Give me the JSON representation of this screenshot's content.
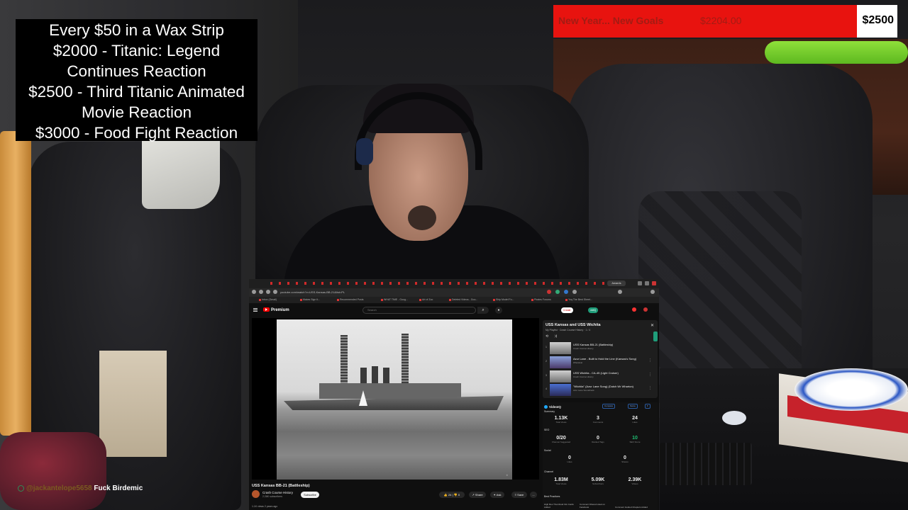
{
  "overlay": {
    "goal_list": [
      "Every $50 in a Wax Strip",
      "$2000 - Titanic: Legend",
      "Continues Reaction",
      "$2500 - Third Titanic Animated",
      "Movie Reaction",
      "$3000 - Food Fight Reaction"
    ],
    "goal_bar": {
      "title": "New Year... New Goals",
      "current": "$2204.00",
      "target": "$2500",
      "progress_percent": 88.2,
      "fill_color": "#e8130f"
    },
    "chat": {
      "username": "@jackantelope5658",
      "message": "Fuck Birdemic"
    }
  },
  "browser": {
    "tab_label": "Awards",
    "url": "youtube.com/watch?v=USS-Kansas-BB-21&list=PL",
    "bookmarks": [
      "Inbox (Gmail)",
      "Makes Sign It...",
      "Recommended Posts",
      "WHAT TIME - Goog...",
      "Art of Zoo",
      "Deleted Videos - Goo...",
      "Ship Model Fo...",
      "Pirates Forums",
      "Yoq The Best Sheet..."
    ],
    "youtube": {
      "logo": "Premium",
      "search_placeholder": "Search",
      "search_icon": "search-icon",
      "mic_icon": "mic-icon",
      "header_pills": [
        "Create",
        "vidIQ"
      ],
      "video_title": "USS Kansas BB-21 (Battleship)",
      "channel_name": "Crash Course History",
      "channel_subs": "2.26K subscribers",
      "subscribe_label": "Subscribe",
      "actions": {
        "like": "24",
        "dislike": "0",
        "share": "Share",
        "ask": "Ask",
        "save": "Save",
        "more": "..."
      },
      "views_line": "1.1K views  2 years ago",
      "playlist": {
        "title": "USS Kansas and USS Wichita",
        "meta": "My Playlist · Crash Course History · 1 / 4",
        "items": [
          {
            "index": "1",
            "title": "USS Kansas BB-21 (Battleship)",
            "sub": "Crash Course History"
          },
          {
            "index": "2",
            "title": "Azur Lane - Built to Hold the Line (Kansas's Song)",
            "sub": "Whostical"
          },
          {
            "index": "3",
            "title": "USS Wichita - CA-45 (Light Cruiser)",
            "sub": "Crash Course History"
          },
          {
            "index": "4",
            "title": "\"Wichita\" (Azur Lane Song) (Dutch Wr Wharton)",
            "sub": "Azur Lane Soundtrack"
          }
        ]
      },
      "vidiq": {
        "logo": "VideoIQ",
        "pills": [
          "Compare",
          "Score"
        ],
        "sections": [
          "Summary",
          "SEO",
          "Social",
          "Channel",
          "Best Practices"
        ],
        "stats": [
          {
            "num": "1.13K",
            "label": "Total Views"
          },
          {
            "num": "3",
            "label": "Comments"
          },
          {
            "num": "24",
            "label": "Likes"
          },
          {
            "num": "0/20",
            "label": "Channel Suggested"
          },
          {
            "num": "0",
            "label": "Ranked Tags"
          },
          {
            "num": "10",
            "label": "SEO Score"
          },
          {
            "num": "0",
            "label": "Likes"
          },
          {
            "num": "0",
            "label": "Shares"
          },
          {
            "num": "1.83M",
            "label": "Total Views"
          },
          {
            "num": "5.09K",
            "label": "Subscribers"
          },
          {
            "num": "2.39K",
            "label": "Videos"
          }
        ],
        "footer": [
          "High Res Thumbnail Info Cards Added",
          "Comment Filtered Liked on Facebook",
          "Comment Guided Chapters Added"
        ]
      }
    }
  }
}
